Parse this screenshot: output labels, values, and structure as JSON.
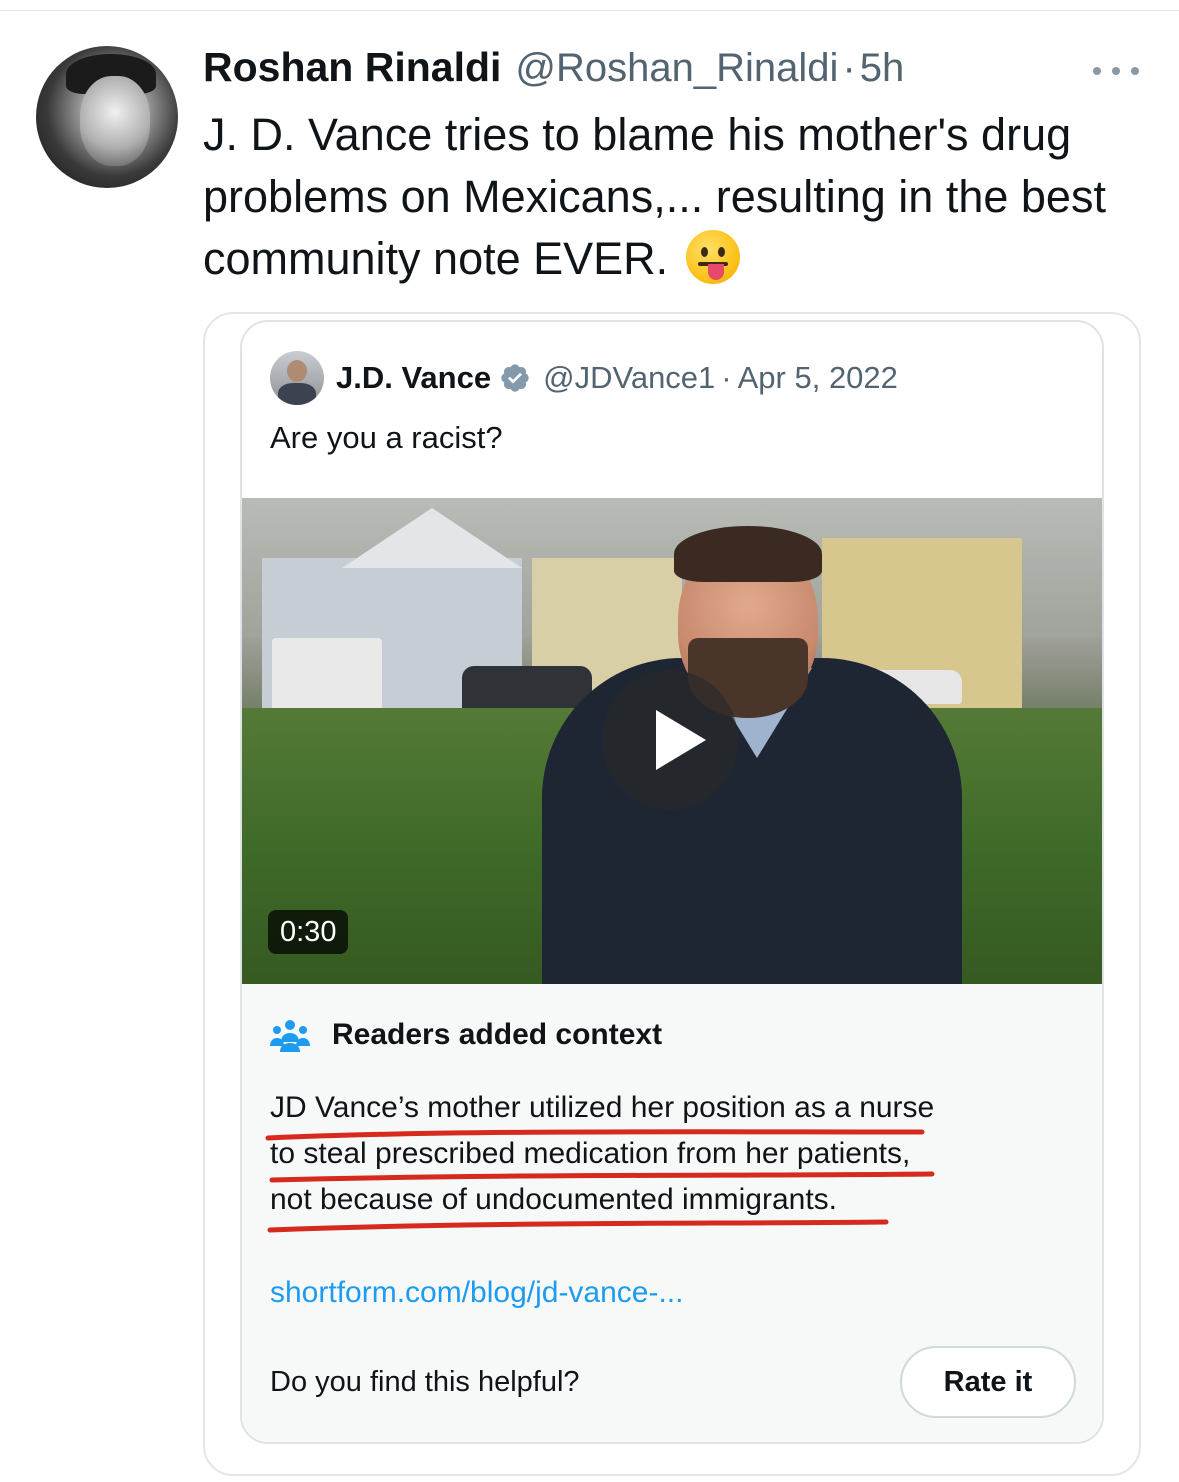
{
  "post": {
    "author_name": "Roshan Rinaldi",
    "author_handle": "@Roshan_Rinaldi",
    "separator": "·",
    "time": "5h",
    "text": "J. D. Vance tries to blame his mother's drug problems on Mexicans,... resulting in the best community note EVER.",
    "emoji_icon": "face-with-tongue-icon"
  },
  "quoted": {
    "author_name": "J.D. Vance",
    "verified_icon": "verified-badge-icon",
    "author_handle": "@JDVance1",
    "separator": "·",
    "date": "Apr 5, 2022",
    "text": "Are you a racist?",
    "video_duration": "0:30"
  },
  "community_note": {
    "title": "Readers added context",
    "lines": [
      "JD Vance’s mother utilized her position as a nurse",
      "to steal prescribed medication from her patients,",
      "not because of undocumented immigrants."
    ],
    "link_text": "shortform.com/blog/jd-vance-...",
    "helpful_question": "Do you find this helpful?",
    "rate_label": "Rate it",
    "underline_color": "#d62a1e"
  },
  "colors": {
    "link": "#1d9bf0",
    "verified": "#829aab",
    "secondary_text": "#536471"
  }
}
